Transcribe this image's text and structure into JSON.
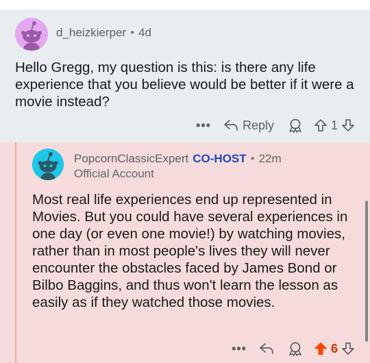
{
  "colors": {
    "parent_bg": "#e9edef",
    "reply_bg": "#f5dbdb",
    "thread_line": "#f0a89c",
    "cohost": "#1b48c6",
    "upvote_active": "#ff4500",
    "avatar_parent": "#e3a8ef",
    "avatar_reply": "#1fc6e8"
  },
  "parent_comment": {
    "username": "d_heizkierper",
    "separator": "•",
    "age": "4d",
    "body": "Hello Gregg, my question is this: is there any life experience that you believe would be better if it were a movie instead?",
    "actions": {
      "more": "•••",
      "reply_label": "Reply",
      "vote_count": "1"
    }
  },
  "reply_comment": {
    "username": "PopcornClassicExpert",
    "badge": "CO-HOST",
    "separator": "•",
    "age": "22m",
    "flair": "Official Account",
    "body": "Most real life experiences end up represented in Movies. But you could have several experiences in one day (or even one movie!) by watching movies, rather than in most people's lives they will never encounter the obstacles faced by James Bond or Bilbo Baggins, and thus won't learn the lesson as easily as if they watched those movies.",
    "actions": {
      "more": "•••",
      "vote_count": "6"
    }
  },
  "icons": [
    "snoo-avatar-icon",
    "reply-arrow-icon",
    "award-icon",
    "upvote-icon",
    "downvote-icon",
    "more-icon"
  ]
}
